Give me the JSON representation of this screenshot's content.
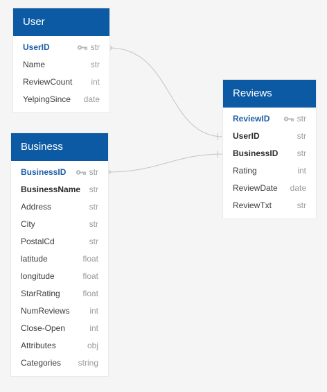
{
  "tables": {
    "user": {
      "title": "User",
      "fields": [
        {
          "name": "UserID",
          "type": "str"
        },
        {
          "name": "Name",
          "type": "str"
        },
        {
          "name": "ReviewCount",
          "type": "int"
        },
        {
          "name": "YelpingSince",
          "type": "date"
        }
      ]
    },
    "business": {
      "title": "Business",
      "fields": [
        {
          "name": "BusinessID",
          "type": "str"
        },
        {
          "name": "BusinessName",
          "type": "str"
        },
        {
          "name": "Address",
          "type": "str"
        },
        {
          "name": "City",
          "type": "str"
        },
        {
          "name": "PostalCd",
          "type": "str"
        },
        {
          "name": "latitude",
          "type": "float"
        },
        {
          "name": "longitude",
          "type": "float"
        },
        {
          "name": "StarRating",
          "type": "float"
        },
        {
          "name": "NumReviews",
          "type": "int"
        },
        {
          "name": "Close-Open",
          "type": "int"
        },
        {
          "name": "Attributes",
          "type": "obj"
        },
        {
          "name": "Categories",
          "type": "string"
        }
      ]
    },
    "reviews": {
      "title": "Reviews",
      "fields": [
        {
          "name": "ReviewID",
          "type": "str"
        },
        {
          "name": "UserID",
          "type": "str"
        },
        {
          "name": "BusinessID",
          "type": "str"
        },
        {
          "name": "Rating",
          "type": "int"
        },
        {
          "name": "ReviewDate",
          "type": "date"
        },
        {
          "name": "ReviewTxt",
          "type": "str"
        }
      ]
    }
  },
  "relationships": [
    {
      "from": "User.UserID",
      "to": "Reviews.UserID",
      "cardinality": "one-to-many"
    },
    {
      "from": "Business.BusinessID",
      "to": "Reviews.BusinessID",
      "cardinality": "one-to-many"
    }
  ],
  "colors": {
    "header": "#0c5aa4",
    "primary_key": "#1e5ea8",
    "link": "#c4c4c4",
    "key_icon": "#b8b8b8"
  },
  "icons": {
    "primary_key": "key-icon"
  }
}
